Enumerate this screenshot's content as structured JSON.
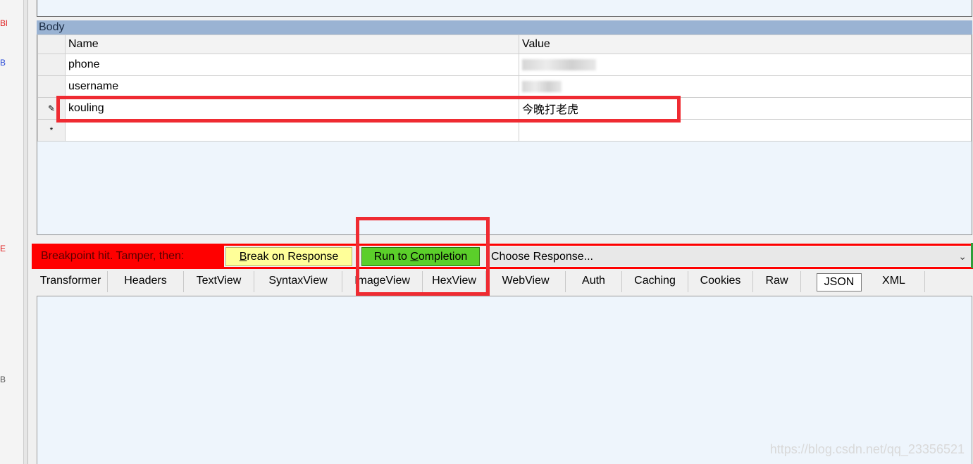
{
  "left_strip": {
    "fragments": [
      {
        "text": "Bl",
        "color": "#e02020"
      },
      {
        "text": "B",
        "color": "#2a4bd7"
      },
      {
        "text": "E",
        "color": "#e02020"
      },
      {
        "text": "B",
        "color": "#555555"
      }
    ]
  },
  "body_section": {
    "header": "Body",
    "columns": [
      "Name",
      "Value"
    ],
    "rows": [
      {
        "marker": "",
        "name": "phone",
        "value": "",
        "value_redacted": true
      },
      {
        "marker": "",
        "name": "username",
        "value": "",
        "value_redacted": true
      },
      {
        "marker": "✎",
        "name": "kouling",
        "value": "今晚打老虎",
        "value_redacted": false
      },
      {
        "marker": "*",
        "name": "",
        "value": "",
        "value_redacted": false
      }
    ]
  },
  "breakpoint_bar": {
    "label": "Breakpoint hit. Tamper, then:",
    "break_button": {
      "pre": "",
      "ul": "B",
      "post": "reak on Response"
    },
    "run_button": {
      "pre": "Run to ",
      "ul": "C",
      "post": "ompletion"
    },
    "response_select": "Choose Response...",
    "colors": {
      "bar": "#ff0000",
      "break_btn": "#ffff99",
      "run_btn": "#5bcf2a"
    }
  },
  "tabs": [
    "Transformer",
    "Headers",
    "TextView",
    "SyntaxView",
    "ImageView",
    "HexView",
    "WebView",
    "Auth",
    "Caching",
    "Cookies",
    "Raw",
    "JSON",
    "XML"
  ],
  "selected_tab": "JSON",
  "watermark": "https://blog.csdn.net/qq_23356521"
}
